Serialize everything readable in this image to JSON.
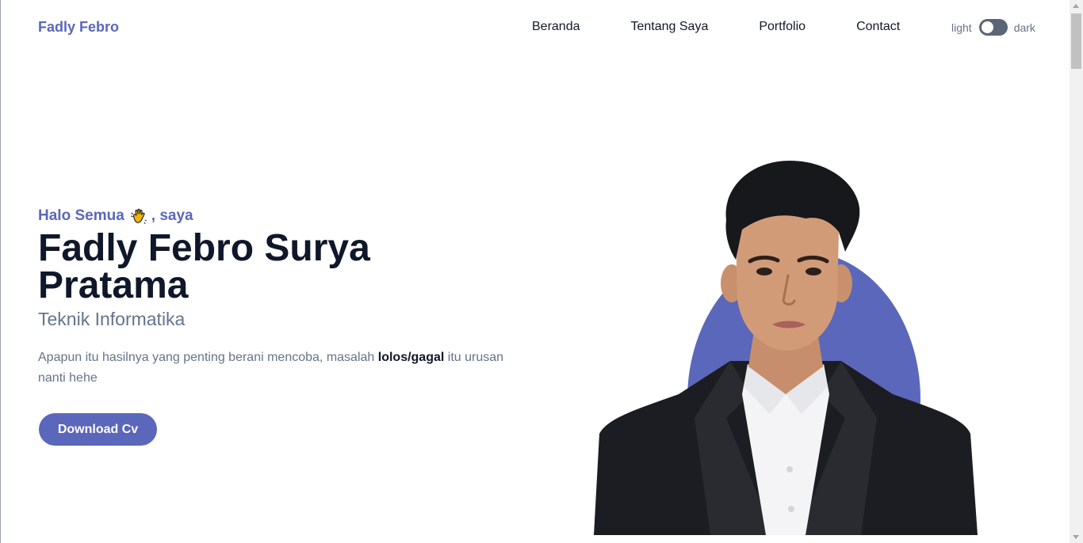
{
  "header": {
    "brand": "Fadly Febro",
    "nav": [
      {
        "label": "Beranda"
      },
      {
        "label": "Tentang Saya"
      },
      {
        "label": "Portfolio"
      },
      {
        "label": "Contact"
      }
    ],
    "theme": {
      "light_label": "light",
      "dark_label": "dark"
    }
  },
  "hero": {
    "greeting_prefix": "Halo Semua",
    "greeting_icon": "waving-hand-icon",
    "greeting_suffix": ", saya",
    "name": "Fadly Febro Surya Pratama",
    "role": "Teknik Informatika",
    "description_before": "Apapun itu hasilnya yang penting berani mencoba, masalah",
    "description_bold": "lolos/gagal",
    "description_after": "itu urusan nanti hehe",
    "cv_button": "Download Cv"
  },
  "colors": {
    "accent": "#5a67ba",
    "heading": "#0f172a",
    "muted": "#64748b",
    "toggle": "#5b6577"
  }
}
